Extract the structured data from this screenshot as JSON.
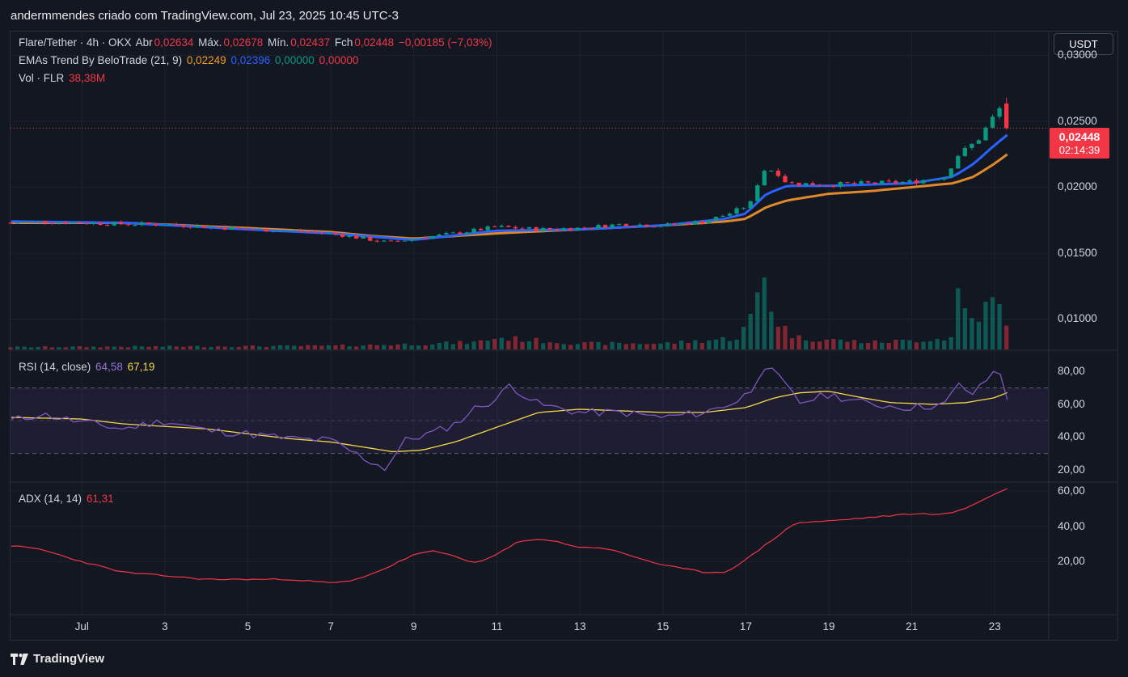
{
  "header": {
    "caption": "andermmendes criado com TradingView.com, Jul 23, 2025 10:45 UTC-3"
  },
  "legend": {
    "symbol": "Flare/Tether · 4h · OKX",
    "open_label": "Abr",
    "open": "0,02634",
    "high_label": "Máx.",
    "high": "0,02678",
    "low_label": "Mín.",
    "low": "0,02437",
    "close_label": "Fch",
    "close": "0,02448",
    "change": "−0,00185 (−7,03%)",
    "ema_name": "EMAs Trend By BeloTrade (21, 9)",
    "ema_21": "0,02249",
    "ema_9": "0,02396",
    "ema_v3": "0,00000",
    "ema_v4": "0,00000",
    "vol_name": "Vol · FLR",
    "vol_value": "38,38M",
    "rsi_name": "RSI (14, close)",
    "rsi_value": "64,58",
    "rsi_ma": "67,19",
    "adx_name": "ADX (14, 14)",
    "adx_value": "61,31"
  },
  "currency_button": "USDT",
  "last_price_tag": {
    "price": "0,02448",
    "countdown": "02:14:39"
  },
  "brand": "TradingView",
  "colors": {
    "up": "#089981",
    "down": "#f23645",
    "ema9": "#2962ff",
    "ema21": "#e0892a",
    "rsi": "#7e57c2",
    "rsi_ma": "#f5d94a",
    "adx": "#f23645",
    "background": "#131722"
  },
  "chart_data": [
    {
      "type": "candlestick",
      "title": "Flare/Tether · 4h · OKX",
      "ylim": [
        0.0077,
        0.0318
      ],
      "y_ticks": [
        "0,03000",
        "0,02500",
        "0,02000",
        "0,01500",
        "0,01000"
      ],
      "y_tick_values": [
        0.03,
        0.025,
        0.02,
        0.015,
        0.01
      ],
      "x_ticks": [
        "Jul",
        "3",
        "5",
        "7",
        "9",
        "11",
        "13",
        "15",
        "17",
        "19",
        "21",
        "23"
      ],
      "x_tick_days": [
        1,
        3,
        5,
        7,
        9,
        11,
        13,
        15,
        17,
        19,
        21,
        23
      ],
      "x_range_days": [
        -0.72,
        24.3
      ],
      "close_anchors": [
        [
          -0.7,
          0.0173
        ],
        [
          0.0,
          0.0174
        ],
        [
          1.0,
          0.0173
        ],
        [
          2.0,
          0.0172
        ],
        [
          3.0,
          0.0172
        ],
        [
          4.0,
          0.017
        ],
        [
          5.0,
          0.0168
        ],
        [
          6.0,
          0.0167
        ],
        [
          7.0,
          0.0165
        ],
        [
          8.0,
          0.016
        ],
        [
          8.4,
          0.0158
        ],
        [
          9.0,
          0.0161
        ],
        [
          10.0,
          0.0165
        ],
        [
          11.0,
          0.017
        ],
        [
          12.0,
          0.0168
        ],
        [
          13.0,
          0.0169
        ],
        [
          14.0,
          0.0172
        ],
        [
          15.0,
          0.0171
        ],
        [
          16.0,
          0.0174
        ],
        [
          16.6,
          0.018
        ],
        [
          17.1,
          0.0187
        ],
        [
          17.4,
          0.0213
        ],
        [
          17.7,
          0.0213
        ],
        [
          18.0,
          0.0203
        ],
        [
          19.0,
          0.0202
        ],
        [
          20.0,
          0.0203
        ],
        [
          21.0,
          0.0204
        ],
        [
          21.8,
          0.0208
        ],
        [
          22.1,
          0.0224
        ],
        [
          22.6,
          0.0236
        ],
        [
          23.0,
          0.0255
        ],
        [
          23.2,
          0.0263
        ],
        [
          23.3,
          0.02448
        ]
      ],
      "last": {
        "open": 0.02634,
        "high": 0.02678,
        "low": 0.02437,
        "close": 0.02448
      },
      "ema_anchors": {
        "ema9": [
          [
            -0.7,
            0.0174
          ],
          [
            2.0,
            0.0173
          ],
          [
            5.0,
            0.0168
          ],
          [
            7.0,
            0.0165
          ],
          [
            9.0,
            0.016
          ],
          [
            11.0,
            0.0167
          ],
          [
            13.0,
            0.0168
          ],
          [
            15.0,
            0.0171
          ],
          [
            16.5,
            0.0176
          ],
          [
            17.0,
            0.018
          ],
          [
            17.5,
            0.0195
          ],
          [
            18.0,
            0.0201
          ],
          [
            19.0,
            0.0201
          ],
          [
            20.0,
            0.0202
          ],
          [
            21.0,
            0.0203
          ],
          [
            22.0,
            0.0208
          ],
          [
            22.5,
            0.0218
          ],
          [
            23.0,
            0.0232
          ],
          [
            23.3,
            0.02396
          ]
        ],
        "ema21": [
          [
            -0.7,
            0.0173
          ],
          [
            2.0,
            0.0173
          ],
          [
            5.0,
            0.0169
          ],
          [
            7.0,
            0.0166
          ],
          [
            8.0,
            0.0163
          ],
          [
            9.0,
            0.0161
          ],
          [
            11.0,
            0.0165
          ],
          [
            13.0,
            0.0168
          ],
          [
            15.0,
            0.0171
          ],
          [
            16.5,
            0.0174
          ],
          [
            17.0,
            0.0176
          ],
          [
            17.5,
            0.0185
          ],
          [
            18.0,
            0.019
          ],
          [
            19.0,
            0.0195
          ],
          [
            20.0,
            0.0197
          ],
          [
            21.0,
            0.02
          ],
          [
            22.0,
            0.0203
          ],
          [
            22.5,
            0.0208
          ],
          [
            23.0,
            0.0218
          ],
          [
            23.3,
            0.02249
          ]
        ]
      }
    },
    {
      "type": "bar",
      "title": "Vol · FLR",
      "volume_anchors": [
        [
          -0.7,
          4
        ],
        [
          7.0,
          6
        ],
        [
          9.0,
          9
        ],
        [
          10.5,
          12
        ],
        [
          11.0,
          20
        ],
        [
          13.0,
          10
        ],
        [
          15.0,
          10
        ],
        [
          16.0,
          15
        ],
        [
          16.8,
          20
        ],
        [
          17.2,
          60
        ],
        [
          17.4,
          140
        ],
        [
          17.7,
          50
        ],
        [
          18.2,
          20
        ],
        [
          20.0,
          12
        ],
        [
          21.0,
          15
        ],
        [
          22.0,
          20
        ],
        [
          22.1,
          100
        ],
        [
          22.4,
          50
        ],
        [
          22.8,
          70
        ],
        [
          23.0,
          85
        ],
        [
          23.3,
          40
        ]
      ],
      "vmax": 140
    },
    {
      "type": "line",
      "title": "RSI (14, close)",
      "ylim": [
        13,
        93
      ],
      "y_ticks": [
        "80,00",
        "60,00",
        "40,00",
        "20,00"
      ],
      "y_tick_values": [
        80,
        60,
        40,
        20
      ],
      "bands": [
        30,
        50,
        70
      ],
      "rsi_anchors": [
        [
          -0.7,
          50
        ],
        [
          0.0,
          54
        ],
        [
          1.0,
          49
        ],
        [
          2.0,
          45
        ],
        [
          3.0,
          50
        ],
        [
          4.0,
          44
        ],
        [
          5.0,
          42
        ],
        [
          6.0,
          39
        ],
        [
          7.0,
          38
        ],
        [
          7.8,
          27
        ],
        [
          8.3,
          21
        ],
        [
          8.8,
          38
        ],
        [
          9.5,
          43
        ],
        [
          10.0,
          48
        ],
        [
          10.5,
          58
        ],
        [
          11.0,
          63
        ],
        [
          11.3,
          72
        ],
        [
          12.0,
          60
        ],
        [
          13.0,
          55
        ],
        [
          14.0,
          55
        ],
        [
          15.0,
          52
        ],
        [
          16.0,
          55
        ],
        [
          16.8,
          62
        ],
        [
          17.2,
          70
        ],
        [
          17.4,
          85
        ],
        [
          17.8,
          76
        ],
        [
          18.3,
          61
        ],
        [
          19.0,
          66
        ],
        [
          20.0,
          60
        ],
        [
          21.0,
          58
        ],
        [
          21.8,
          60
        ],
        [
          22.1,
          72
        ],
        [
          22.5,
          66
        ],
        [
          22.9,
          78
        ],
        [
          23.1,
          82
        ],
        [
          23.3,
          64.58
        ]
      ],
      "ma_anchors": [
        [
          -0.7,
          52
        ],
        [
          1.0,
          51
        ],
        [
          2.0,
          48
        ],
        [
          4.0,
          45
        ],
        [
          5.0,
          42
        ],
        [
          6.0,
          39
        ],
        [
          7.0,
          37
        ],
        [
          8.0,
          33
        ],
        [
          8.5,
          31
        ],
        [
          9.2,
          32
        ],
        [
          10.0,
          37
        ],
        [
          11.0,
          46
        ],
        [
          12.0,
          55
        ],
        [
          13.0,
          57
        ],
        [
          14.0,
          56
        ],
        [
          15.0,
          55
        ],
        [
          16.0,
          55
        ],
        [
          17.0,
          58
        ],
        [
          17.7,
          64
        ],
        [
          18.3,
          67
        ],
        [
          19.0,
          68
        ],
        [
          19.8,
          64
        ],
        [
          20.5,
          61
        ],
        [
          21.5,
          60
        ],
        [
          22.3,
          61
        ],
        [
          23.0,
          64
        ],
        [
          23.3,
          67.19
        ]
      ]
    },
    {
      "type": "line",
      "title": "ADX (14, 14)",
      "ylim": [
        -10,
        65
      ],
      "y_ticks": [
        "60,00",
        "40,00",
        "20,00"
      ],
      "y_tick_values": [
        60,
        40,
        20
      ],
      "adx_anchors": [
        [
          -0.7,
          29
        ],
        [
          0.0,
          27
        ],
        [
          1.0,
          20
        ],
        [
          2.0,
          14
        ],
        [
          3.0,
          12
        ],
        [
          4.0,
          10
        ],
        [
          5.0,
          10
        ],
        [
          6.0,
          10
        ],
        [
          7.0,
          8
        ],
        [
          7.5,
          9
        ],
        [
          8.3,
          16
        ],
        [
          9.0,
          24
        ],
        [
          9.5,
          26
        ],
        [
          10.0,
          23
        ],
        [
          10.5,
          19
        ],
        [
          11.0,
          24
        ],
        [
          11.5,
          31
        ],
        [
          12.0,
          33
        ],
        [
          12.5,
          31
        ],
        [
          13.0,
          28
        ],
        [
          13.5,
          28
        ],
        [
          14.0,
          25
        ],
        [
          15.0,
          18
        ],
        [
          16.0,
          14
        ],
        [
          16.5,
          14
        ],
        [
          17.0,
          21
        ],
        [
          17.5,
          30
        ],
        [
          18.2,
          42
        ],
        [
          19.0,
          43
        ],
        [
          20.0,
          45
        ],
        [
          21.0,
          47
        ],
        [
          21.8,
          47
        ],
        [
          22.2,
          49
        ],
        [
          22.7,
          55
        ],
        [
          23.3,
          61.31
        ]
      ]
    }
  ]
}
